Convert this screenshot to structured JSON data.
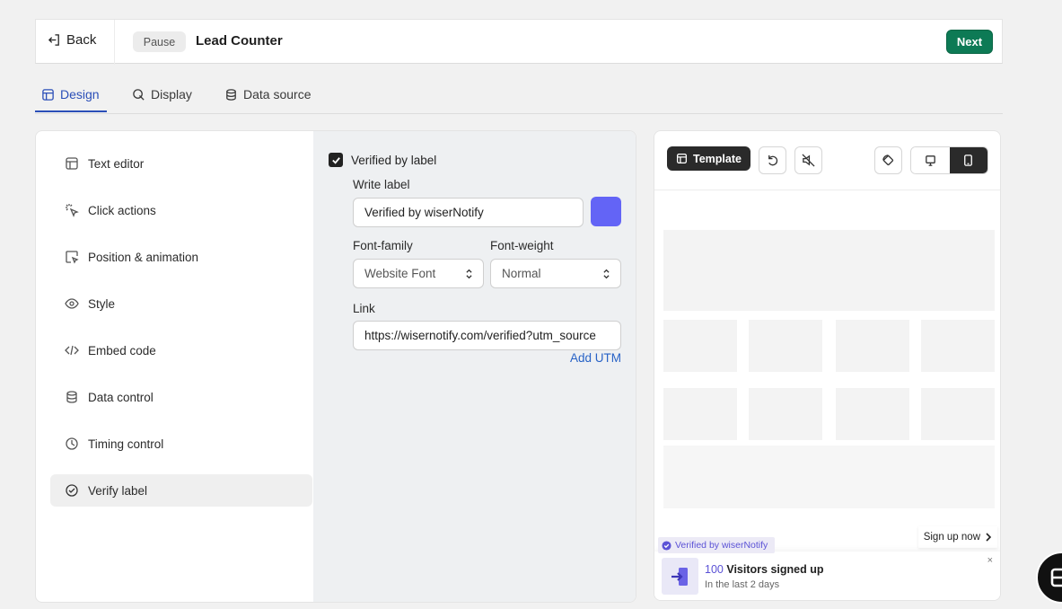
{
  "header": {
    "back_label": "Back",
    "status_label": "Pause",
    "title": "Lead Counter",
    "next_label": "Next"
  },
  "tabs": [
    {
      "label": "Design",
      "icon": "design-icon",
      "active": true
    },
    {
      "label": "Display",
      "icon": "display-icon",
      "active": false
    },
    {
      "label": "Data source",
      "icon": "database-icon",
      "active": false
    }
  ],
  "sidebar": {
    "items": [
      {
        "label": "Text editor",
        "icon": "layout-icon"
      },
      {
        "label": "Click actions",
        "icon": "cursor-click-icon"
      },
      {
        "label": "Position & animation",
        "icon": "position-icon"
      },
      {
        "label": "Style",
        "icon": "eye-icon"
      },
      {
        "label": "Embed code",
        "icon": "code-icon"
      },
      {
        "label": "Data control",
        "icon": "database-icon"
      },
      {
        "label": "Timing control",
        "icon": "clock-icon"
      },
      {
        "label": "Verify label",
        "icon": "check-circle-icon",
        "active": true
      }
    ]
  },
  "form": {
    "checkbox_label": "Verified by label",
    "checkbox_checked": true,
    "write_label_title": "Write label",
    "write_label_value": "Verified by wiserNotify",
    "label_color": "#6364f6",
    "font_family_title": "Font-family",
    "font_family_value": "Website Font",
    "font_weight_title": "Font-weight",
    "font_weight_value": "Normal",
    "link_title": "Link",
    "link_value": "https://wisernotify.com/verified?utm_source",
    "add_utm_label": "Add UTM"
  },
  "preview": {
    "template_label": "Template",
    "badge_text": "Verified by wiserNotify",
    "signup_label": "Sign up now",
    "count": "100",
    "headline_rest": "Visitors signed up",
    "subtext": "In the last 2 days",
    "close_glyph": "×"
  },
  "colors": {
    "primary_green": "#0d7a55",
    "accent_blue": "#2b4fb8",
    "accent_purple": "#5b52d6"
  }
}
